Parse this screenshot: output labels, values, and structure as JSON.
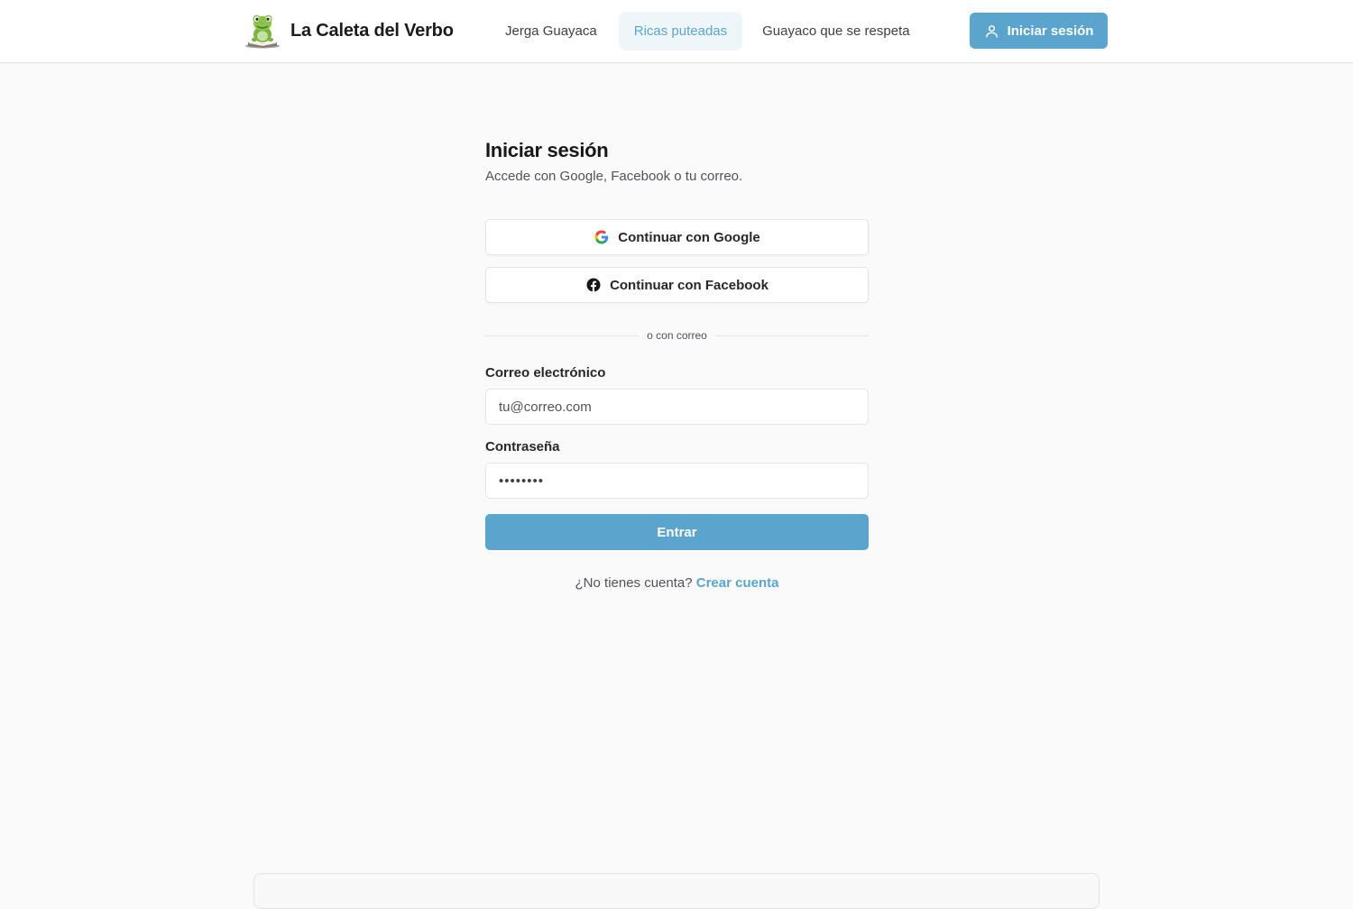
{
  "header": {
    "brand_name": "La Caleta del Verbo",
    "logo_icon": "frog-reading-book-icon",
    "nav": [
      {
        "label": "Jerga Guayaca",
        "active": false
      },
      {
        "label": "Ricas puteadas",
        "active": true
      },
      {
        "label": "Guayaco que se respeta",
        "active": false
      }
    ],
    "login_button": {
      "label": "Iniciar sesión",
      "icon": "user-icon"
    }
  },
  "login": {
    "title": "Iniciar sesión",
    "subtitle": "Accede con Google, Facebook o tu correo.",
    "google_button": {
      "label": "Continuar con Google",
      "icon": "google-icon"
    },
    "facebook_button": {
      "label": "Continuar con Facebook",
      "icon": "facebook-icon"
    },
    "divider_text": "o con correo",
    "email": {
      "label": "Correo electrónico",
      "placeholder": "tu@correo.com",
      "value": ""
    },
    "password": {
      "label": "Contraseña",
      "value": "••••••••"
    },
    "submit_label": "Entrar",
    "signup_prompt": "¿No tienes cuenta?",
    "signup_link": "Crear cuenta"
  },
  "colors": {
    "accent": "#5ba4cd",
    "nav_active_bg": "#eef6fa",
    "page_bg": "#fafafa"
  }
}
